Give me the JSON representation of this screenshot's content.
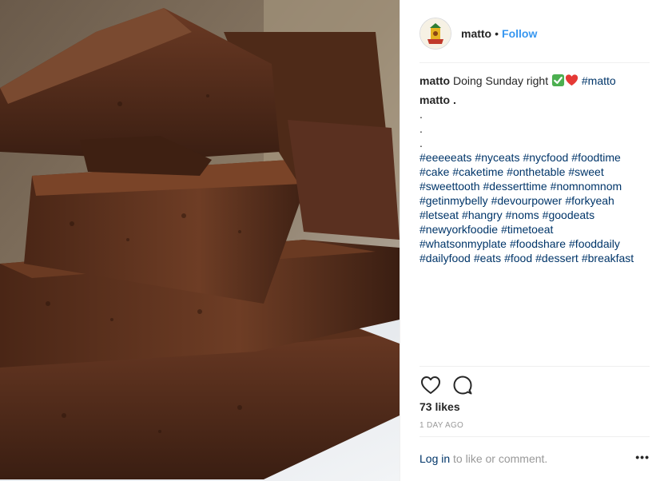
{
  "post": {
    "username": "matto",
    "dot": "•",
    "follow_label": "Follow",
    "caption": {
      "user": "matto",
      "text": " Doing Sunday right ",
      "emojis": [
        "check-mark-emoji",
        "heart-emoji"
      ],
      "inline_tag": "#matto",
      "second_line": "matto .",
      "dots": [
        ".",
        ".",
        "."
      ],
      "hashtags": [
        "#eeeeeats",
        "#nyceats",
        "#nycfood",
        "#foodtime",
        "#cake",
        "#caketime",
        "#onthetable",
        "#sweet",
        "#sweettooth",
        "#desserttime",
        "#nomnomnom",
        "#getinmybelly",
        "#devourpower",
        "#forkyeah",
        "#letseat",
        "#hangry",
        "#noms",
        "#goodeats",
        "#newyorkfoodie",
        "#timetoeat",
        "#whatsonmyplate",
        "#foodshare",
        "#fooddaily",
        "#dailyfood",
        "#eats",
        "#food",
        "#dessert",
        "#breakfast"
      ]
    },
    "likes": "73 likes",
    "time": "1 DAY AGO",
    "footer": {
      "login": "Log in",
      "rest": " to like or comment.",
      "more": "•••"
    },
    "icons": {
      "like": "heart-outline-icon",
      "comment": "comment-bubble-icon",
      "more": "more-options-icon"
    },
    "colors": {
      "link": "#3897f0",
      "hashtag": "#003569",
      "muted": "#999999",
      "text": "#262626"
    }
  }
}
